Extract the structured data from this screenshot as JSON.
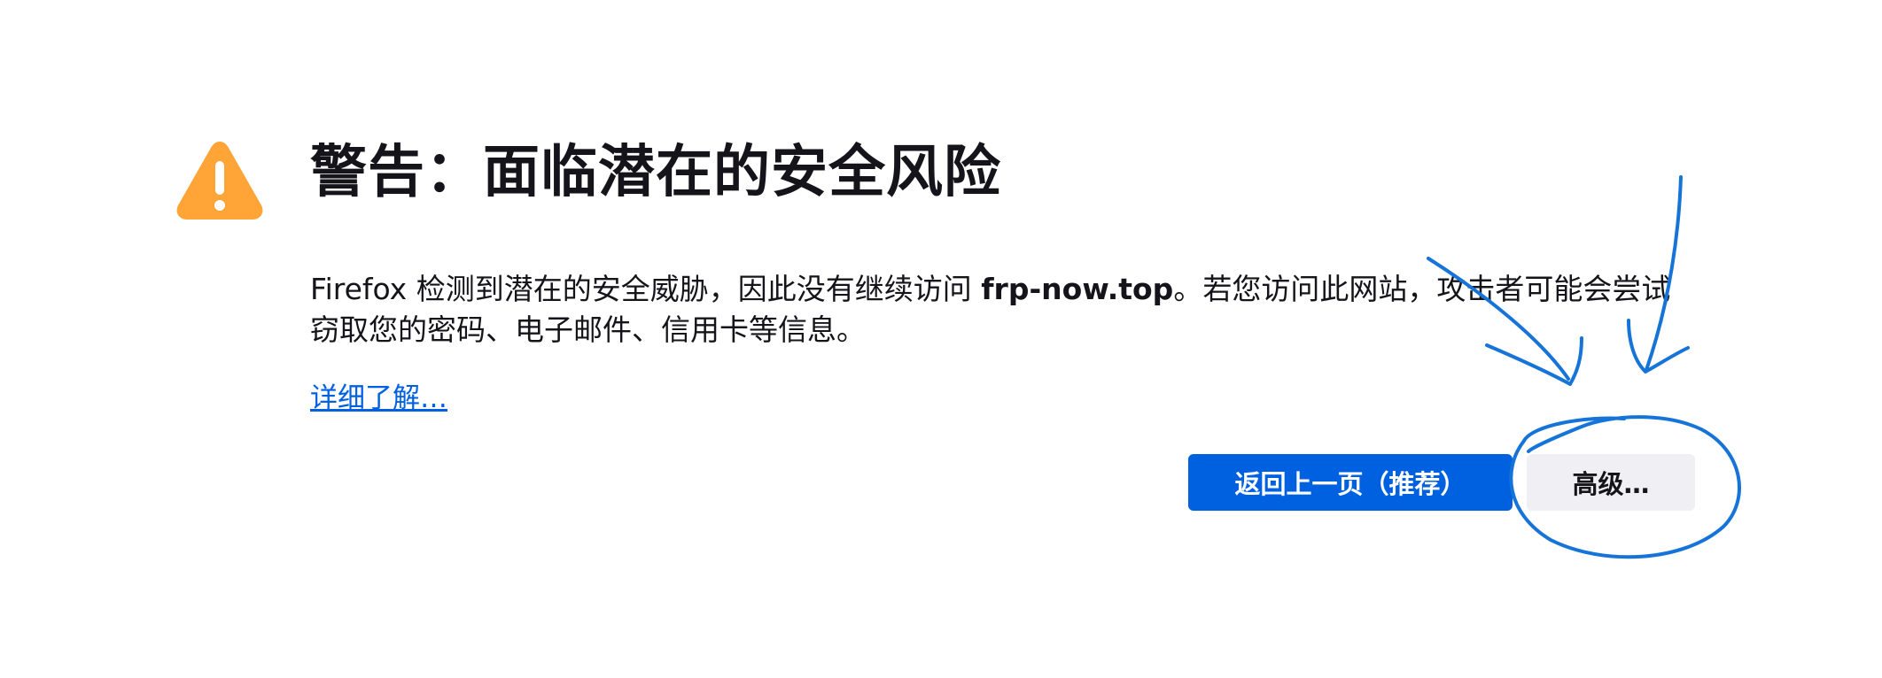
{
  "error_page": {
    "title": "警告：面临潜在的安全风险",
    "description": {
      "part1": "Firefox 检测到潜在的安全威胁，因此没有继续访问 ",
      "domain": "frp-now.top",
      "part2": "。若您访问此网站，攻击者可能会尝试窃取您的密码、电子邮件、信用卡等信息。"
    },
    "learn_more": "详细了解…",
    "buttons": {
      "go_back": "返回上一页（推荐）",
      "advanced": "高级…"
    }
  },
  "colors": {
    "warning_icon": "#ffa436",
    "primary_button": "#0061e0",
    "secondary_button": "#f0f0f4",
    "link": "#0061e0",
    "annotation_ink": "#1674d8"
  },
  "icons": {
    "warning": "warning-triangle-icon"
  }
}
